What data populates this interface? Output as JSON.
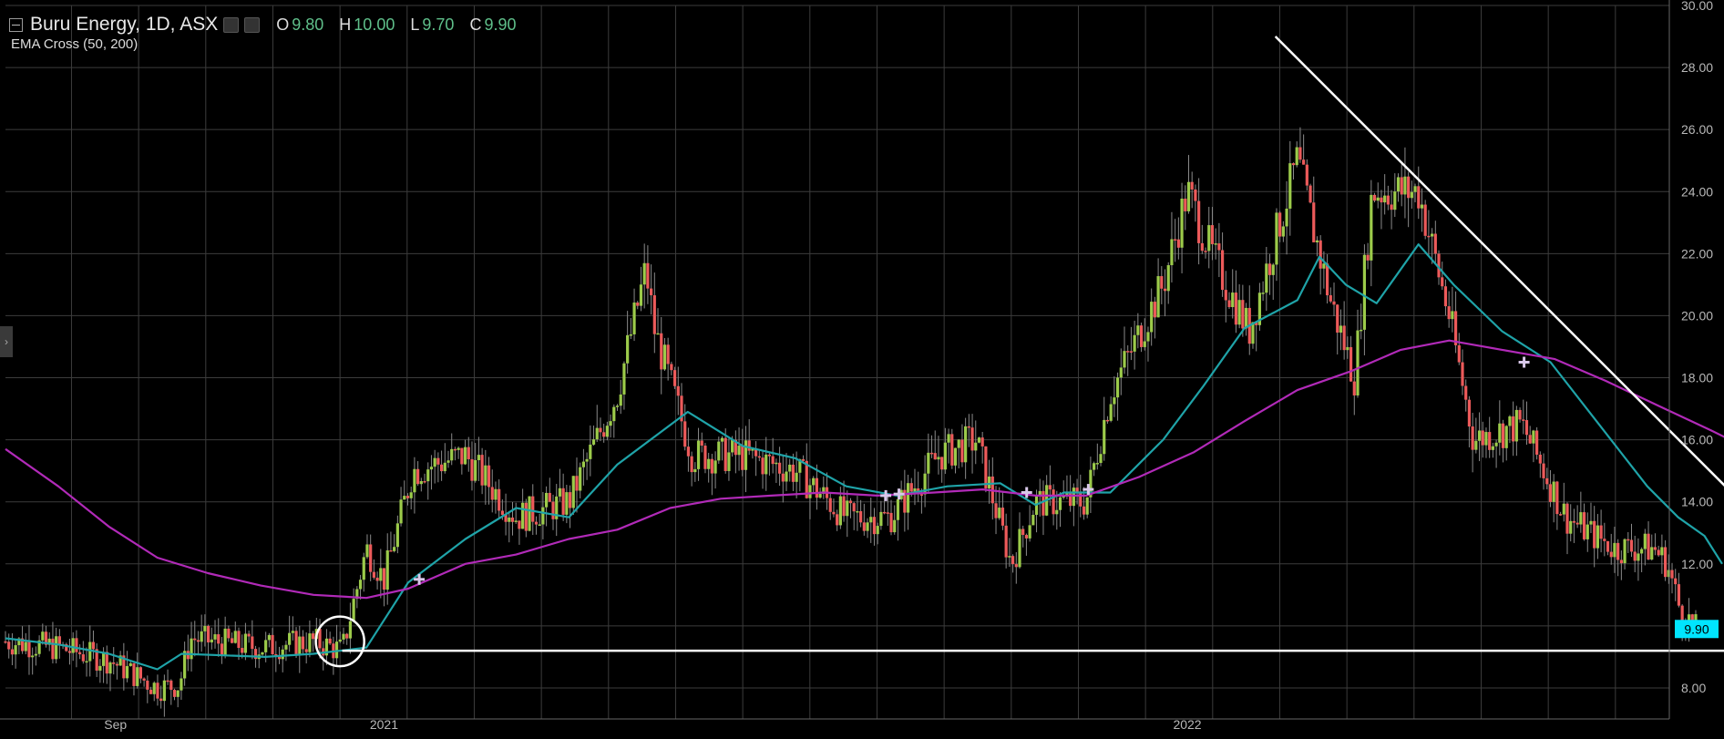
{
  "legend": {
    "title": "Buru Energy, 1D, ASX",
    "ohlc": [
      {
        "key": "O",
        "value": "9.80"
      },
      {
        "key": "H",
        "value": "10.00"
      },
      {
        "key": "L",
        "value": "9.70"
      },
      {
        "key": "C",
        "value": "9.90"
      }
    ],
    "indicator": "EMA Cross (50, 200)",
    "value_color": "#5fbf8a"
  },
  "colors": {
    "background": "#000000",
    "grid": "#3c3c3c",
    "up": "#9ccb4a",
    "down": "#ec5a5a",
    "ema50": "#1fa3a8",
    "ema200": "#b12ab8",
    "trendline": "#ffffff",
    "price_tag": "#00e5ff"
  },
  "side_handle": "›",
  "chart_data": {
    "type": "line",
    "title": "Buru Energy, 1D, ASX",
    "ylim": [
      7.0,
      30.0
    ],
    "y_ticks": [
      "30.00",
      "28.00",
      "26.00",
      "24.00",
      "22.00",
      "20.00",
      "18.00",
      "16.00",
      "14.00",
      "12.00",
      "10.00",
      "8.00"
    ],
    "x_range": [
      "2020-07-13",
      "2022-08-08"
    ],
    "x_ticks": [
      {
        "date": "2020-09-01",
        "label": "Sep"
      },
      {
        "date": "2021-01-01",
        "label": "2021"
      },
      {
        "date": "2022-01-01",
        "label": "2022"
      }
    ],
    "grid": true,
    "last_price": "9.90",
    "price_anchors": [
      [
        "2020-07-13",
        9.5
      ],
      [
        "2020-08-06",
        9.3
      ],
      [
        "2020-08-29",
        8.9
      ],
      [
        "2020-09-20",
        8.0
      ],
      [
        "2020-09-30",
        8.1
      ],
      [
        "2020-10-05",
        9.6
      ],
      [
        "2020-11-06",
        9.3
      ],
      [
        "2020-11-30",
        9.5
      ],
      [
        "2020-12-13",
        9.2
      ],
      [
        "2020-12-24",
        12.5
      ],
      [
        "2021-01-01",
        11.5
      ],
      [
        "2021-01-14",
        15.0
      ],
      [
        "2021-02-07",
        15.5
      ],
      [
        "2021-03-02",
        13.5
      ],
      [
        "2021-03-26",
        14.0
      ],
      [
        "2021-04-17",
        17.5
      ],
      [
        "2021-04-30",
        21.5
      ],
      [
        "2021-05-04",
        19.5
      ],
      [
        "2021-05-21",
        15.5
      ],
      [
        "2021-06-13",
        15.5
      ],
      [
        "2021-07-07",
        15.0
      ],
      [
        "2021-07-30",
        13.5
      ],
      [
        "2021-08-19",
        13.5
      ],
      [
        "2021-09-10",
        15.5
      ],
      [
        "2021-09-27",
        16.0
      ],
      [
        "2021-10-13",
        12.0
      ],
      [
        "2021-10-24",
        14.0
      ],
      [
        "2021-11-16",
        14.0
      ],
      [
        "2021-11-27",
        17.5
      ],
      [
        "2021-12-21",
        21.0
      ],
      [
        "2022-01-01",
        24.0
      ],
      [
        "2022-01-12",
        22.0
      ],
      [
        "2022-01-29",
        19.5
      ],
      [
        "2022-02-20",
        25.0
      ],
      [
        "2022-03-07",
        20.5
      ],
      [
        "2022-03-18",
        18.0
      ],
      [
        "2022-03-26",
        24.0
      ],
      [
        "2022-04-16",
        24.0
      ],
      [
        "2022-04-30",
        20.0
      ],
      [
        "2022-05-11",
        16.0
      ],
      [
        "2022-06-02",
        16.5
      ],
      [
        "2022-06-22",
        13.5
      ],
      [
        "2022-07-14",
        12.5
      ],
      [
        "2022-08-01",
        12.5
      ],
      [
        "2022-08-07",
        12.0
      ],
      [
        "2022-08-13",
        10.5
      ],
      [
        "2022-08-20",
        9.9
      ]
    ],
    "series": [
      {
        "points": [
          [
            "2020-07-13",
            9.6
          ],
          [
            "2020-08-06",
            9.4
          ],
          [
            "2020-08-29",
            9.1
          ],
          [
            "2020-09-20",
            8.6
          ],
          [
            "2020-10-01",
            9.1
          ],
          [
            "2020-11-08",
            9.0
          ],
          [
            "2020-11-30",
            9.1
          ],
          [
            "2020-12-24",
            9.3
          ],
          [
            "2021-01-12",
            11.4
          ],
          [
            "2021-02-07",
            12.8
          ],
          [
            "2021-03-02",
            13.8
          ],
          [
            "2021-03-26",
            13.5
          ],
          [
            "2021-04-17",
            15.2
          ],
          [
            "2021-05-19",
            16.9
          ],
          [
            "2021-06-13",
            15.8
          ],
          [
            "2021-07-07",
            15.4
          ],
          [
            "2021-07-30",
            14.5
          ],
          [
            "2021-08-22",
            14.2
          ],
          [
            "2021-09-14",
            14.5
          ],
          [
            "2021-10-08",
            14.6
          ],
          [
            "2021-10-24",
            13.9
          ],
          [
            "2021-11-06",
            14.3
          ],
          [
            "2021-11-27",
            14.3
          ],
          [
            "2021-12-21",
            16.0
          ],
          [
            "2022-01-08",
            17.7
          ],
          [
            "2022-01-27",
            19.6
          ],
          [
            "2022-02-20",
            20.5
          ],
          [
            "2022-03-02",
            21.9
          ],
          [
            "2022-03-14",
            21.0
          ],
          [
            "2022-03-28",
            20.4
          ],
          [
            "2022-04-16",
            22.3
          ],
          [
            "2022-05-02",
            21.0
          ],
          [
            "2022-05-24",
            19.5
          ],
          [
            "2022-06-15",
            18.5
          ],
          [
            "2022-07-07",
            16.5
          ],
          [
            "2022-07-29",
            14.5
          ],
          [
            "2022-08-12",
            13.5
          ],
          [
            "2022-08-24",
            12.9
          ],
          [
            "2022-09-01",
            12.0
          ]
        ]
      },
      {
        "points": [
          [
            "2020-07-13",
            15.7
          ],
          [
            "2020-08-06",
            14.5
          ],
          [
            "2020-08-29",
            13.2
          ],
          [
            "2020-09-20",
            12.2
          ],
          [
            "2020-10-13",
            11.7
          ],
          [
            "2020-11-06",
            11.3
          ],
          [
            "2020-11-30",
            11.0
          ],
          [
            "2020-12-24",
            10.9
          ],
          [
            "2021-01-12",
            11.2
          ],
          [
            "2021-02-07",
            12.0
          ],
          [
            "2021-03-02",
            12.3
          ],
          [
            "2021-03-26",
            12.8
          ],
          [
            "2021-04-17",
            13.1
          ],
          [
            "2021-05-11",
            13.8
          ],
          [
            "2021-06-03",
            14.1
          ],
          [
            "2021-06-26",
            14.2
          ],
          [
            "2021-07-20",
            14.3
          ],
          [
            "2021-08-13",
            14.2
          ],
          [
            "2021-09-08",
            14.3
          ],
          [
            "2021-09-30",
            14.4
          ],
          [
            "2021-10-24",
            14.2
          ],
          [
            "2021-11-16",
            14.2
          ],
          [
            "2021-12-10",
            14.8
          ],
          [
            "2022-01-04",
            15.6
          ],
          [
            "2022-01-27",
            16.6
          ],
          [
            "2022-02-20",
            17.6
          ],
          [
            "2022-03-16",
            18.2
          ],
          [
            "2022-04-08",
            18.9
          ],
          [
            "2022-04-30",
            19.2
          ],
          [
            "2022-05-24",
            18.9
          ],
          [
            "2022-06-17",
            18.6
          ],
          [
            "2022-07-10",
            17.9
          ],
          [
            "2022-08-03",
            17.1
          ],
          [
            "2022-08-27",
            16.3
          ],
          [
            "2022-09-19",
            15.5
          ],
          [
            "2022-10-01",
            15.1
          ]
        ]
      }
    ],
    "cross_markers": [
      [
        "2021-01-17",
        11.5
      ],
      [
        "2021-08-17",
        14.2
      ],
      [
        "2021-08-23",
        14.25
      ],
      [
        "2021-10-20",
        14.3
      ],
      [
        "2021-11-17",
        14.4
      ],
      [
        "2022-06-03",
        18.5
      ]
    ],
    "annotations": {
      "support_line": [
        [
          "2020-12-13",
          9.2
        ],
        [
          "2022-11-10",
          9.2
        ]
      ],
      "resistance_line": [
        [
          "2022-02-10",
          29.0
        ],
        [
          "2022-11-19",
          9.0
        ]
      ],
      "circle": {
        "center": [
          "2020-12-12",
          9.5
        ],
        "radius_days": 11,
        "radius_value": 0.8
      }
    }
  }
}
